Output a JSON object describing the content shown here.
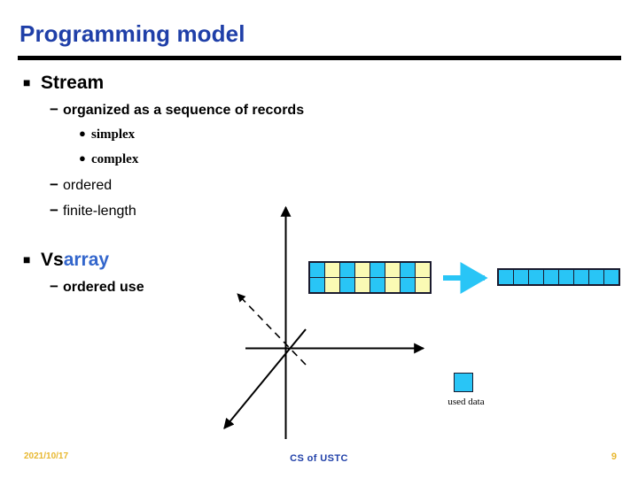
{
  "slide": {
    "title": "Programming model",
    "title_color": "#1F3FA8",
    "accent_color": "#3366CC",
    "rule_color": "#000000"
  },
  "outline": [
    {
      "level": 1,
      "bullet": "square-bullet",
      "marker": "■",
      "text": "Stream"
    },
    {
      "level": 2,
      "bullet": "dash-bullet",
      "marker": "−",
      "text": "organized as a sequence of records"
    },
    {
      "level": 3,
      "bullet": "round-bullet",
      "marker": "●",
      "text": "simplex"
    },
    {
      "level": 3,
      "bullet": "round-bullet",
      "marker": "●",
      "text": "complex"
    },
    {
      "level": 2,
      "bullet": "dash-bullet",
      "marker": "−",
      "text": "ordered"
    },
    {
      "level": 2,
      "bullet": "dash-bullet",
      "marker": "−",
      "text": "finite-length"
    },
    {
      "level": 1,
      "bullet": "square-bullet",
      "marker": "■",
      "text": "Vs ",
      "accent_text": "array"
    },
    {
      "level": 2,
      "bullet": "dash-bullet",
      "marker": "−",
      "text": "ordered use"
    }
  ],
  "diagram": {
    "memory_grid": {
      "rows": 2,
      "cols": 8,
      "pattern": [
        [
          "used",
          "unused",
          "used",
          "unused",
          "used",
          "unused",
          "used",
          "unused"
        ],
        [
          "used",
          "unused",
          "used",
          "unused",
          "used",
          "unused",
          "used",
          "unused"
        ]
      ]
    },
    "packed_array": {
      "rows": 1,
      "cols": 8,
      "pattern": [
        [
          "used",
          "used",
          "used",
          "used",
          "used",
          "used",
          "used",
          "used"
        ]
      ]
    },
    "transform_arrow": "right-arrow-icon",
    "legend": {
      "label": "used data",
      "swatch_color": "#29C5F6"
    },
    "colors": {
      "used": "#29C5F6",
      "unused": "#FAFAB4",
      "cell_border": "#1A1A2E",
      "arrow": "#29C5F6",
      "axis": "#000000"
    },
    "axes": [
      {
        "name": "vertical-axis-arrow",
        "style": "solid"
      },
      {
        "name": "horizontal-axis-arrow",
        "style": "solid"
      },
      {
        "name": "diagonal-axis-arrow",
        "style": "solid"
      },
      {
        "name": "depth-axis-arrow",
        "style": "dashed"
      }
    ]
  },
  "footer": {
    "date": "2021/10/17",
    "center": "CS of USTC",
    "page": "9",
    "date_color": "#E8B830",
    "center_color": "#1F3FA8"
  }
}
